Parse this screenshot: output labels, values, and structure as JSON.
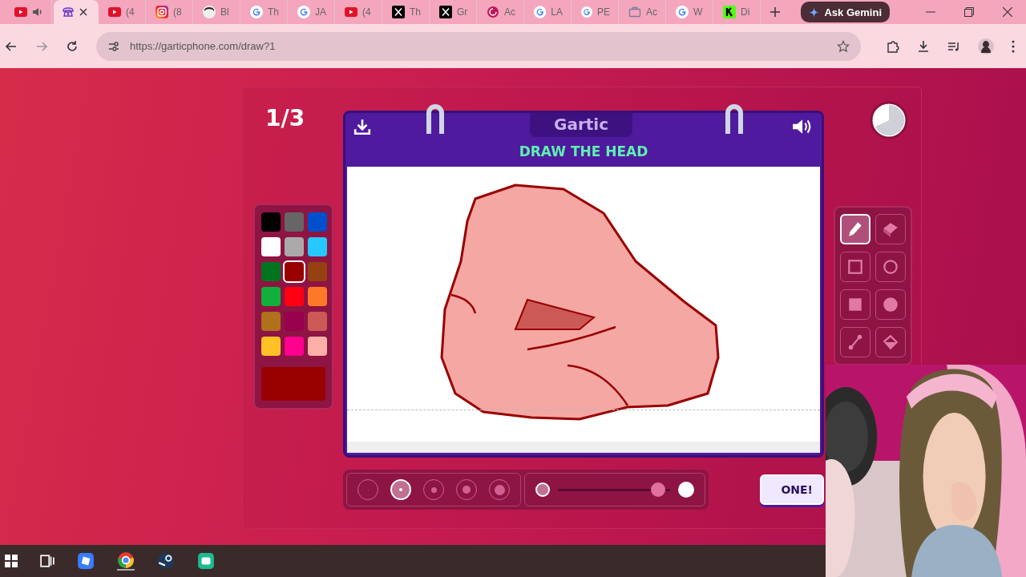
{
  "browser": {
    "tabs": [
      {
        "kind": "youtube",
        "audio": true,
        "selected": false
      },
      {
        "kind": "phone",
        "audio": false,
        "selected": true
      },
      {
        "kind": "youtube",
        "label": "(4",
        "audio": false,
        "selected": false
      },
      {
        "kind": "instagram",
        "label": "(8",
        "audio": false,
        "selected": false
      },
      {
        "kind": "avatar",
        "label": "Bl",
        "audio": false,
        "selected": false
      },
      {
        "kind": "google",
        "label": "Th",
        "audio": false,
        "selected": false
      },
      {
        "kind": "google",
        "label": "JA",
        "audio": false,
        "selected": false
      },
      {
        "kind": "youtube",
        "label": "(4",
        "audio": false,
        "selected": false
      },
      {
        "kind": "x",
        "label": "Th",
        "audio": false,
        "selected": false
      },
      {
        "kind": "x",
        "label": "Gr",
        "audio": false,
        "selected": false
      },
      {
        "kind": "swirl",
        "label": "Ac",
        "audio": false,
        "selected": false
      },
      {
        "kind": "google",
        "label": "LA",
        "audio": false,
        "selected": false
      },
      {
        "kind": "google",
        "label": "PE",
        "audio": false,
        "selected": false
      },
      {
        "kind": "briefcase",
        "label": "Ac",
        "audio": false,
        "selected": false
      },
      {
        "kind": "google",
        "label": "W",
        "audio": false,
        "selected": false
      },
      {
        "kind": "k",
        "label": "Di",
        "audio": false,
        "selected": false
      }
    ],
    "ask_button": "Ask Gemini",
    "url": "https://garticphone.com/draw?1"
  },
  "game": {
    "counter": "1/3",
    "logo": "Gartic",
    "prompt": "DRAW THE HEAD",
    "palette": [
      {
        "color": "#000000",
        "selected": false
      },
      {
        "color": "#666666",
        "selected": false
      },
      {
        "color": "#0050cd",
        "selected": false
      },
      {
        "color": "#ffffff",
        "selected": false
      },
      {
        "color": "#aaaaaa",
        "selected": false
      },
      {
        "color": "#26c9ff",
        "selected": false
      },
      {
        "color": "#017420",
        "selected": false
      },
      {
        "color": "#990000",
        "selected": true
      },
      {
        "color": "#964112",
        "selected": false
      },
      {
        "color": "#11b03c",
        "selected": false
      },
      {
        "color": "#ff0013",
        "selected": false
      },
      {
        "color": "#ff7829",
        "selected": false
      },
      {
        "color": "#b0701c",
        "selected": false
      },
      {
        "color": "#99004e",
        "selected": false
      },
      {
        "color": "#cb5a57",
        "selected": false
      },
      {
        "color": "#ffc126",
        "selected": false
      },
      {
        "color": "#ff008f",
        "selected": false
      },
      {
        "color": "#feafa8",
        "selected": false
      }
    ],
    "tools": [
      {
        "kind": "pencil",
        "selected": true
      },
      {
        "kind": "eraser",
        "selected": false
      },
      {
        "kind": "rect",
        "selected": false
      },
      {
        "kind": "ellipse",
        "selected": false
      },
      {
        "kind": "filledrect",
        "selected": false
      },
      {
        "kind": "filledellipse",
        "selected": false
      },
      {
        "kind": "line",
        "selected": false
      },
      {
        "kind": "fill",
        "selected": false
      }
    ],
    "brush_sizes": [
      {
        "selected": false
      },
      {
        "selected": true
      },
      {
        "selected": false
      },
      {
        "selected": false
      },
      {
        "selected": false
      }
    ],
    "opacity": {
      "level": 0.95
    },
    "done_button": "ONE!"
  }
}
